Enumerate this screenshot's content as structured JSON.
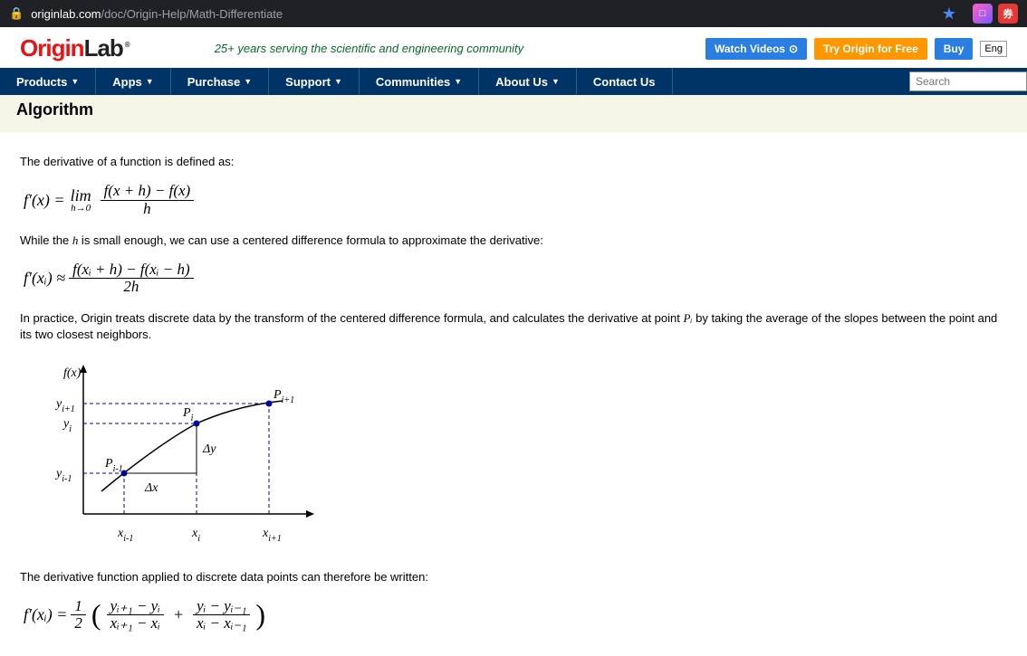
{
  "browser": {
    "host": "originlab.com",
    "path": "/doc/Origin-Help/Math-Differentiate"
  },
  "header": {
    "logo_part1": "Origin",
    "logo_part2": "Lab",
    "tagline": "25+ years serving the scientific and engineering community",
    "watch_videos": "Watch Videos",
    "try_free": "Try Origin for Free",
    "buy": "Buy",
    "language": "Eng"
  },
  "nav": {
    "items": [
      {
        "label": "Products",
        "dropdown": true
      },
      {
        "label": "Apps",
        "dropdown": true
      },
      {
        "label": "Purchase",
        "dropdown": true
      },
      {
        "label": "Support",
        "dropdown": true
      },
      {
        "label": "Communities",
        "dropdown": true
      },
      {
        "label": "About Us",
        "dropdown": true
      },
      {
        "label": "Contact Us",
        "dropdown": false
      }
    ],
    "search_placeholder": "Search"
  },
  "page": {
    "heading": "Algorithm",
    "para1": "The derivative of a function is defined as:",
    "eq1": {
      "lhs": "f′(x) =",
      "lim_top": "lim",
      "lim_bot": "h→0",
      "num": "f(x + h) − f(x)",
      "den": "h"
    },
    "para2_pre": "While the ",
    "para2_h": "h",
    "para2_post": " is small enough, we can use a centered difference formula to approximate the derivative:",
    "eq2": {
      "lhs": "f′(xᵢ) ≈",
      "num": "f(xᵢ + h) − f(xᵢ − h)",
      "den": "2h"
    },
    "para3_pre": "In practice, Origin treats discrete data by the transform of the centered difference formula, and calculates the derivative at point ",
    "para3_p": "Pᵢ",
    "para3_post": " by taking the average of the slopes between the point and its two closest neighbors.",
    "graph": {
      "ylab": "f(x)",
      "y_ip1": "y",
      "y_ip1_sub": "i+1",
      "y_i": "y",
      "y_i_sub": "i",
      "y_im1": "y",
      "y_im1_sub": "i-1",
      "x_im1": "x",
      "x_im1_sub": "i-1",
      "x_i": "x",
      "x_i_sub": "i",
      "x_ip1": "x",
      "x_ip1_sub": "i+1",
      "p_im1": "P",
      "p_im1_sub": "i-1",
      "p_i": "P",
      "p_i_sub": "i",
      "p_ip1": "P",
      "p_ip1_sub": "i+1",
      "dx": "Δx",
      "dy": "Δy"
    },
    "para4": "The derivative function applied to discrete data points can therefore be written:",
    "eq3": {
      "lhs": "f′(xᵢ) =",
      "half_num": "1",
      "half_den": "2",
      "t1_num": "yᵢ₊₁ − yᵢ",
      "t1_den": "xᵢ₊₁ − xᵢ",
      "plus": "+",
      "t2_num": "yᵢ − yᵢ₋₁",
      "t2_den": "xᵢ − xᵢ₋₁"
    }
  }
}
